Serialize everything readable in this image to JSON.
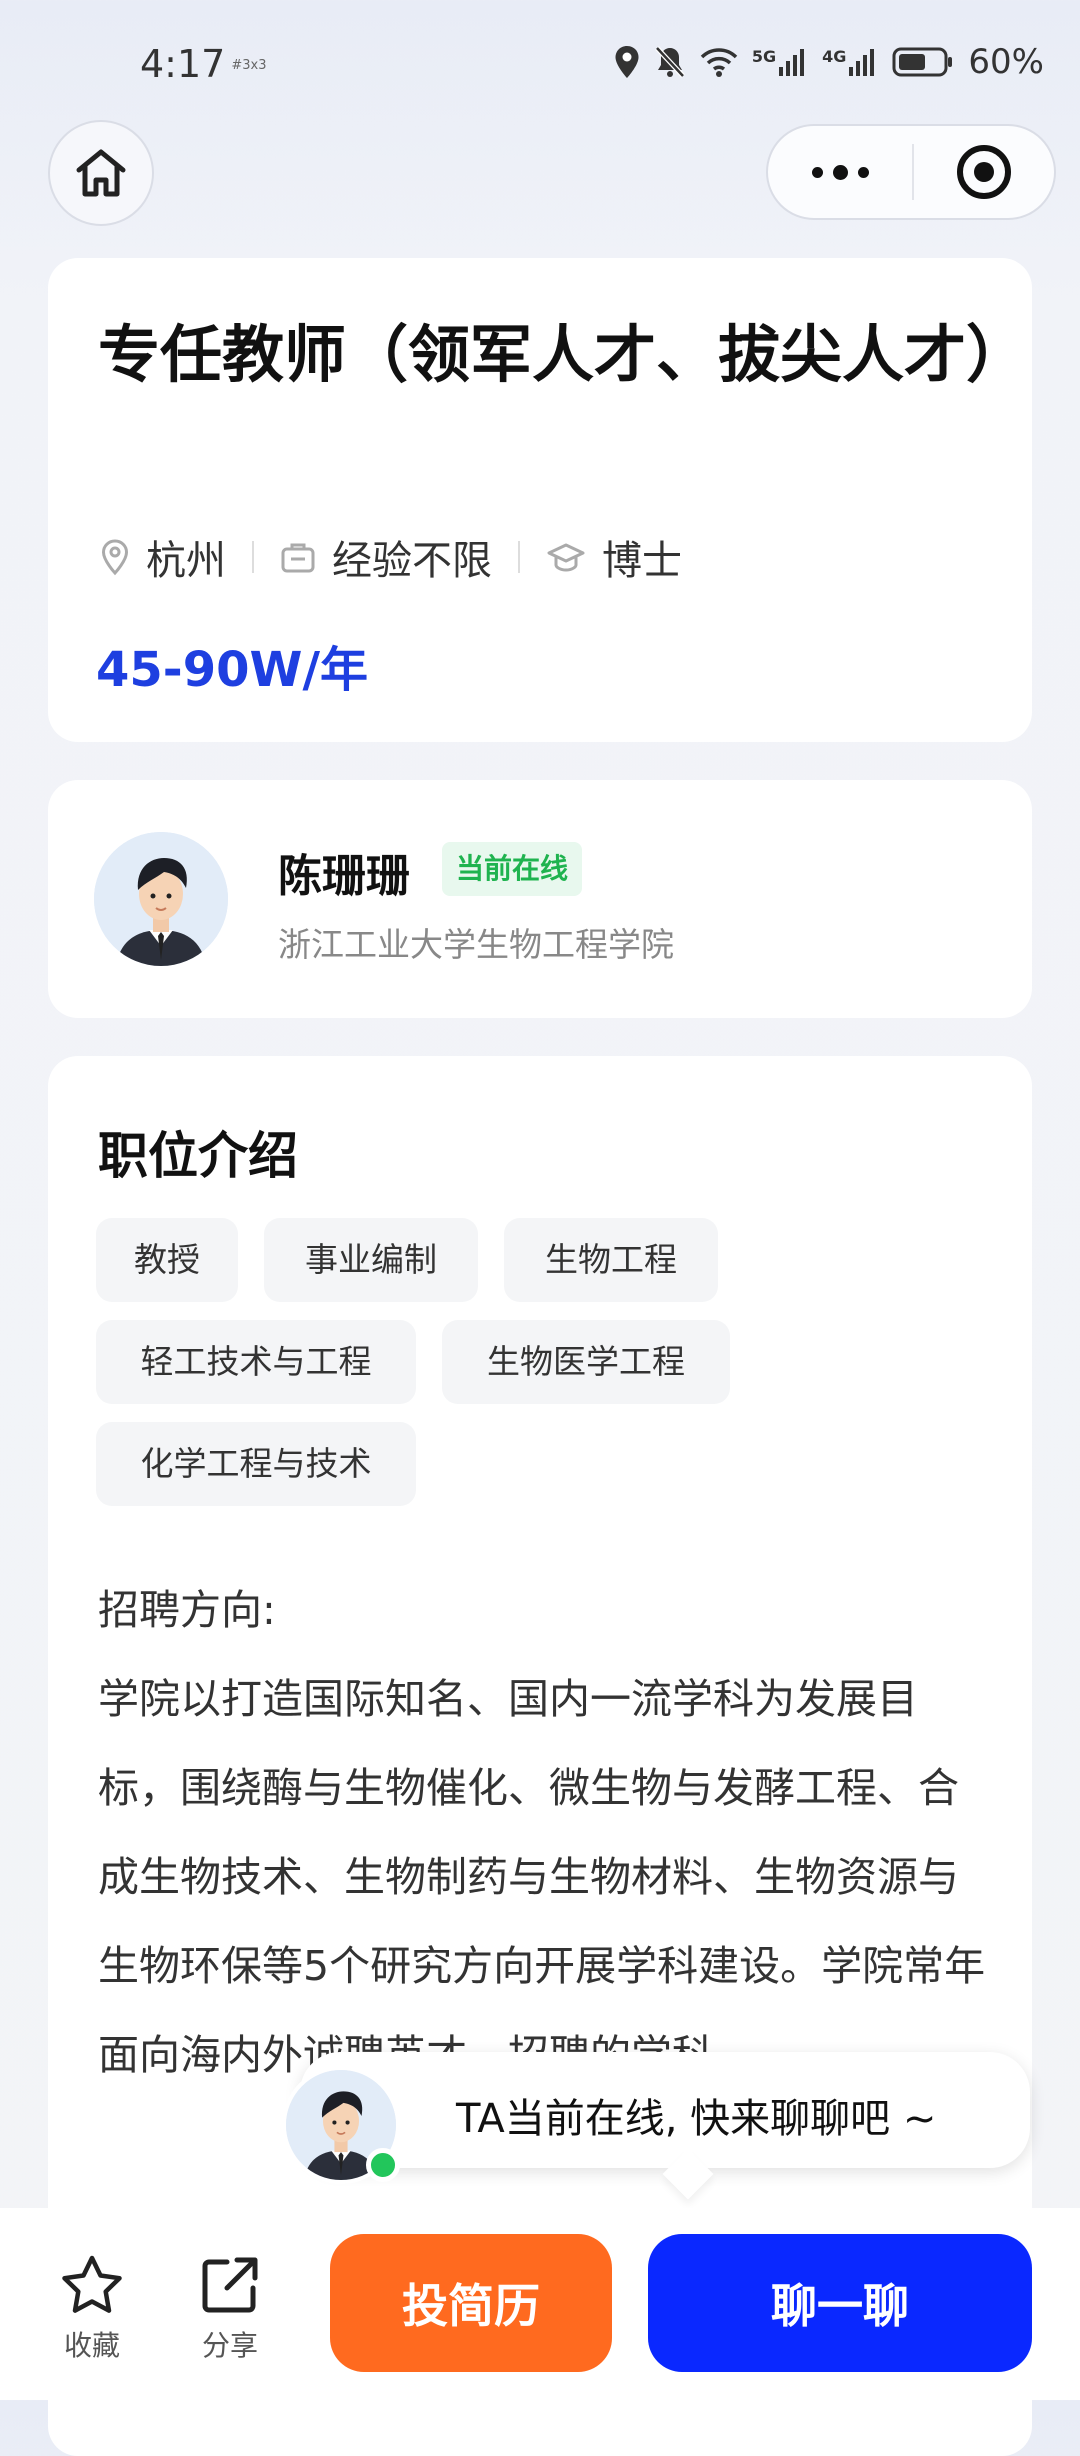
{
  "status_bar": {
    "time": "4:17",
    "time_sub": "#3x3",
    "network_1": "5G",
    "network_2": "4G",
    "battery": "60%"
  },
  "job": {
    "title": "专任教师（领军人才、拔尖人才）",
    "location": "杭州",
    "experience": "经验不限",
    "education": "博士",
    "salary": "45-90W/年"
  },
  "recruiter": {
    "name": "陈珊珊",
    "status": "当前在线",
    "organization": "浙江工业大学生物工程学院"
  },
  "description": {
    "section_title": "职位介绍",
    "tags": [
      "教授",
      "事业编制",
      "生物工程",
      "轻工技术与工程",
      "生物医学工程",
      "化学工程与技术"
    ],
    "text": "招聘方向:\n学院以打造国际知名、国内一流学科为发展目标，围绕酶与生物催化、微生物与发酵工程、合成生物技术、生物制药与生物材料、生物资源与生物环保等5个研究方向开展学科建设。学院常年面向海内外诚聘英才，招聘的学科、"
  },
  "chat_prompt": "TA当前在线, 快来聊聊吧 ~",
  "bottom_bar": {
    "favorite_label": "收藏",
    "share_label": "分享",
    "apply_label": "投简历",
    "chat_label": "聊一聊"
  },
  "colors": {
    "salary": "#1e3fe0",
    "apply_button": "#ff6a1f",
    "chat_button": "#0a28ff",
    "online": "#1fb34f"
  }
}
